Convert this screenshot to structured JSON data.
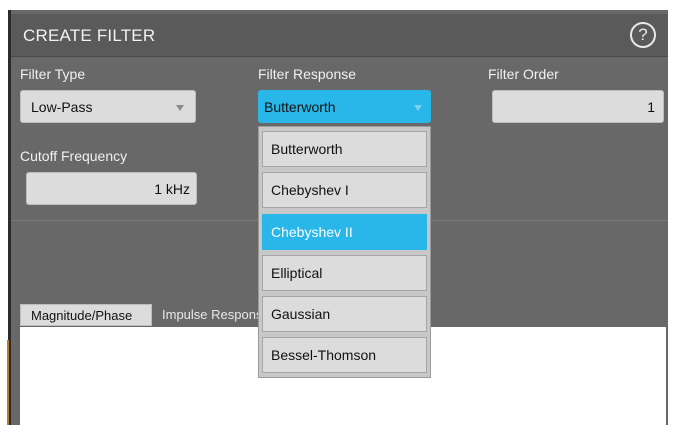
{
  "dialog": {
    "title": "CREATE FILTER",
    "help_glyph": "?"
  },
  "filter_type": {
    "label": "Filter Type",
    "value": "Low-Pass"
  },
  "filter_response": {
    "label": "Filter Response",
    "value": "Butterworth",
    "accent_color": "#29b6e8",
    "options": [
      "Butterworth",
      "Chebyshev I",
      "Chebyshev II",
      "Elliptical",
      "Gaussian",
      "Bessel-Thomson"
    ],
    "highlighted": "Chebyshev II"
  },
  "filter_order": {
    "label": "Filter Order",
    "value": "1"
  },
  "cutoff_frequency": {
    "label": "Cutoff Frequency",
    "value": "1 kHz"
  },
  "tabs": {
    "magnitude_phase": "Magnitude/Phase",
    "impulse_response": "Impulse Response"
  }
}
